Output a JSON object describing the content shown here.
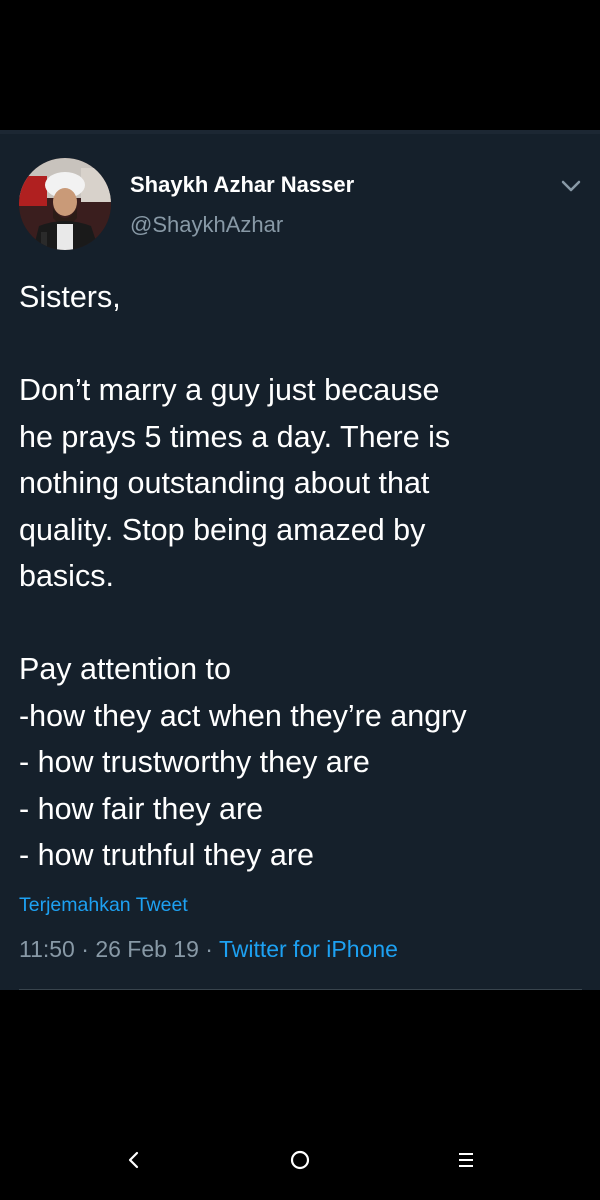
{
  "tweet": {
    "display_name": "Shaykh Azhar Nasser",
    "handle": "@ShaykhAzhar",
    "body_lines": [
      "Sisters,",
      "",
      "Don’t marry a guy just because",
      "he prays 5 times a day. There is",
      "nothing outstanding about that",
      "quality. Stop being amazed by",
      "basics.",
      "",
      "Pay attention to",
      "-how they act when they’re angry",
      "- how trustworthy they are",
      "- how fair they are",
      "- how truthful they are"
    ],
    "translate_label": "Terjemahkan Tweet",
    "time": "11:50",
    "separator": " · ",
    "date": "26 Feb 19",
    "source": "Twitter for iPhone"
  },
  "icons": {
    "more": "chevron-down-icon",
    "back": "back-icon",
    "home": "home-icon",
    "recents": "recents-icon"
  },
  "colors": {
    "background": "#15202b",
    "text": "#ffffff",
    "secondary_text": "#8899a6",
    "accent": "#1da1f2"
  }
}
